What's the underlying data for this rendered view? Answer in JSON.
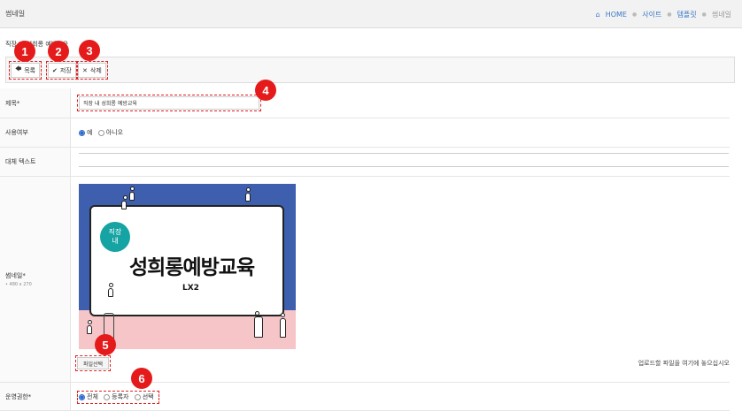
{
  "header": {
    "title": "썸네일",
    "breadcrumbs": [
      "HOME",
      "사이트",
      "템플릿",
      "썸네일"
    ]
  },
  "subtitle": "직장 내 성희롱 예방교육",
  "toolbar": {
    "list_label": "목록",
    "save_label": "저장",
    "delete_label": "삭제"
  },
  "form": {
    "title_label": "제목*",
    "title_value": "직장 내 성희롱 예방교육",
    "use_label": "사용여부",
    "use_options": [
      "예",
      "아니오"
    ],
    "use_selected": "예",
    "alt_label": "대체 텍스트",
    "alt_value": "",
    "thumb_label": "썸네일*",
    "thumb_size": "• 480 x 270",
    "file_button": "파일선택",
    "file_hint": "업로드할 파일을 여기에 놓으십시오",
    "perm_label": "운영권한*",
    "perm_options": [
      "전체",
      "등록자",
      "선택"
    ],
    "perm_selected": "전체"
  },
  "thumbnail_text": {
    "bubble_line1": "직장",
    "bubble_line2": "내",
    "title": "성희롱예방교육",
    "code": "LX2"
  },
  "markers": [
    "1",
    "2",
    "3",
    "4",
    "5",
    "6"
  ],
  "colors": {
    "accent": "#3a78c8",
    "marker": "#e51b1b",
    "thumb_blue": "#3d5fae",
    "thumb_pink": "#f6c5c8",
    "bubble": "#16a3a3"
  }
}
